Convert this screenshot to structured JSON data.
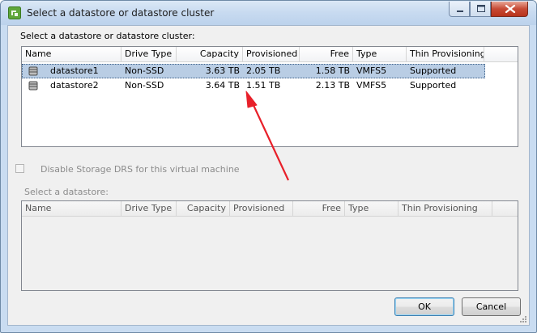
{
  "window": {
    "title": "Select a datastore or datastore cluster"
  },
  "top_section": {
    "label": "Select a datastore or datastore cluster:",
    "columns": [
      "Name",
      "Drive Type",
      "Capacity",
      "Provisioned",
      "Free",
      "Type",
      "Thin Provisioning"
    ],
    "rows": [
      {
        "name": "datastore1",
        "drive_type": "Non-SSD",
        "capacity": "3.63 TB",
        "provisioned": "2.05 TB",
        "free": "1.58 TB",
        "type": "VMFS5",
        "thin_provisioning": "Supported",
        "selected": true
      },
      {
        "name": "datastore2",
        "drive_type": "Non-SSD",
        "capacity": "3.64 TB",
        "provisioned": "1.51 TB",
        "free": "2.13 TB",
        "type": "VMFS5",
        "thin_provisioning": "Supported",
        "selected": false
      }
    ]
  },
  "drs_checkbox": {
    "label": "Disable Storage DRS for this virtual machine",
    "checked": false,
    "enabled": false
  },
  "bottom_section": {
    "label": "Select a datastore:",
    "columns": [
      "Name",
      "Drive Type",
      "Capacity",
      "Provisioned",
      "Free",
      "Type",
      "Thin Provisioning"
    ],
    "enabled": false
  },
  "buttons": {
    "ok_label": "OK",
    "cancel_label": "Cancel"
  },
  "icons": {
    "app": "vsphere-app-icon",
    "datastore": "datastore-icon",
    "annotation": "red-arrow-annotation"
  },
  "colors": {
    "selection": "#b9cde4",
    "annotation_arrow": "#e8202a",
    "titlebar": "#c7daf0"
  }
}
